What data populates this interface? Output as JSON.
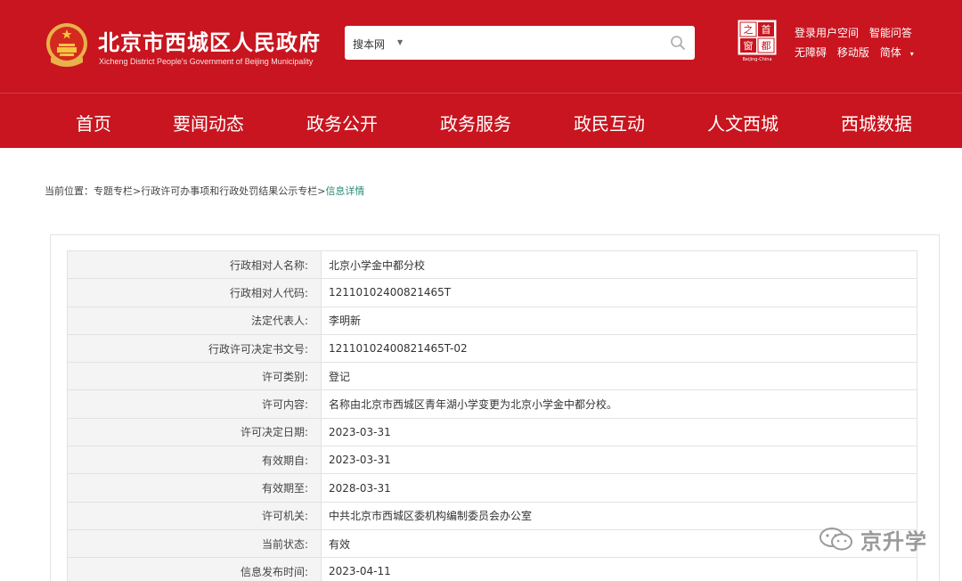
{
  "header": {
    "site_title": "北京市西城区人民政府",
    "site_subtitle": "Xicheng District People's Government of Beijing Municipality",
    "search": {
      "scope": "搜本网",
      "placeholder": ""
    },
    "capital_logo": {
      "chars": [
        "之",
        "首",
        "窗",
        "都"
      ],
      "caption": "Beijing-China"
    },
    "links": {
      "login": "登录用户空间",
      "smart_qa": "智能问答",
      "accessibility": "无障碍",
      "mobile": "移动版",
      "language": "简体"
    }
  },
  "nav": {
    "items": [
      "首页",
      "要闻动态",
      "政务公开",
      "政务服务",
      "政民互动",
      "人文西城",
      "西城数据"
    ]
  },
  "breadcrumb": {
    "prefix": "当前位置：",
    "item1": "专题专栏",
    "sep1": ">",
    "item2": "行政许可办事项和行政处罚结果公示专栏",
    "sep2": ">",
    "current": "信息详情"
  },
  "details": [
    {
      "label": "行政相对人名称:",
      "value": "北京小学金中都分校"
    },
    {
      "label": "行政相对人代码:",
      "value": "12110102400821465T"
    },
    {
      "label": "法定代表人:",
      "value": "李明新"
    },
    {
      "label": "行政许可决定书文号:",
      "value": "12110102400821465T-02"
    },
    {
      "label": "许可类别:",
      "value": "登记"
    },
    {
      "label": "许可内容:",
      "value": "名称由北京市西城区青年湖小学变更为北京小学金中都分校。"
    },
    {
      "label": "许可决定日期:",
      "value": "2023-03-31"
    },
    {
      "label": "有效期自:",
      "value": "2023-03-31"
    },
    {
      "label": "有效期至:",
      "value": "2028-03-31"
    },
    {
      "label": "许可机关:",
      "value": "中共北京市西城区委机构编制委员会办公室"
    },
    {
      "label": "当前状态:",
      "value": "有效"
    },
    {
      "label": "信息发布时间:",
      "value": "2023-04-11"
    }
  ],
  "watermark": {
    "text": "京升学"
  },
  "colors": {
    "brand_red": "#c8151f",
    "breadcrumb_current": "#2a8a7a"
  }
}
